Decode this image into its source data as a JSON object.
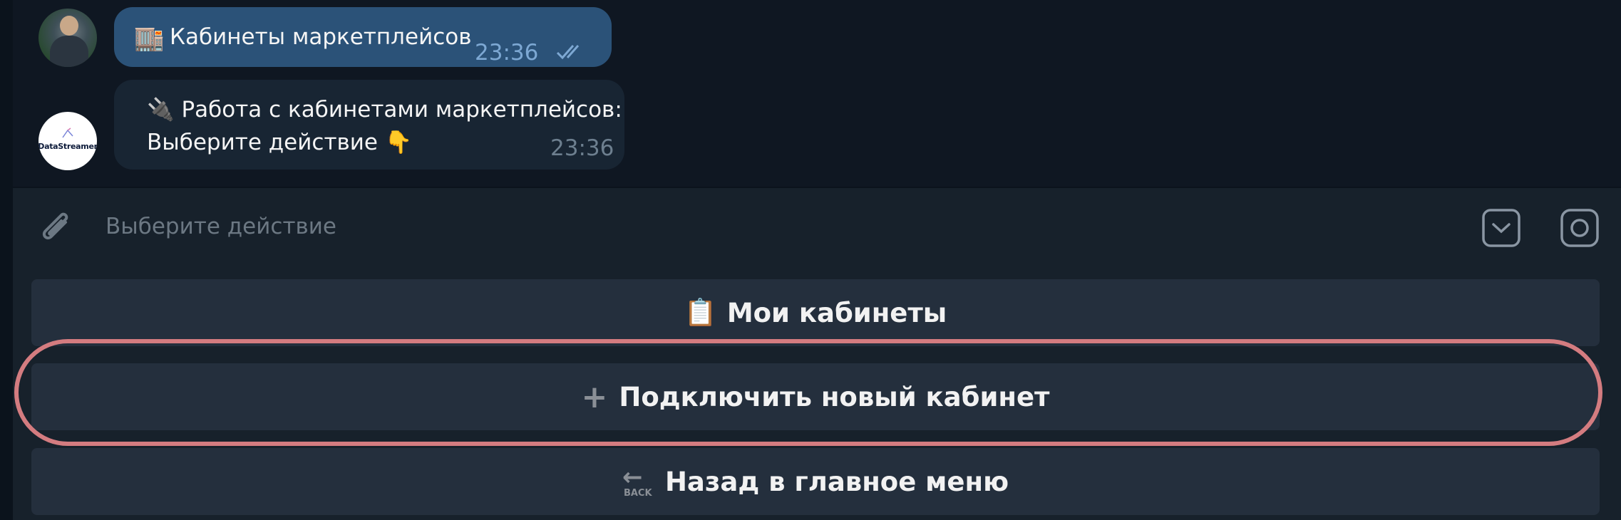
{
  "messages": {
    "outgoing": {
      "emoji": "🏬",
      "text": "Кабинеты маркетплейсов",
      "time": "23:36",
      "status": "read"
    },
    "incoming": {
      "emoji": "🔌",
      "line1": "Работа с кабинетами маркетплейсов:",
      "line2": "Выберите действие",
      "line2_emoji": "👇",
      "time": "23:36",
      "bot_avatar_text": "DataStreamer"
    }
  },
  "composer": {
    "placeholder": "Выберите действие"
  },
  "keyboard": [
    {
      "emoji": "📋",
      "label": "Мои кабинеты"
    },
    {
      "emoji": "➕",
      "label": "Подключить новый кабинет"
    },
    {
      "emoji": "🔙",
      "emoji_text": "BACK",
      "label": "Назад в главное меню"
    }
  ],
  "colors": {
    "background": "#0e1621",
    "outgoing_bubble": "#2b5278",
    "incoming_bubble": "#182533",
    "composer": "#17212b",
    "keyboard_button": "#242f3d",
    "highlight": "#d47c80"
  },
  "highlighted_button": "Подключить новый кабинет"
}
